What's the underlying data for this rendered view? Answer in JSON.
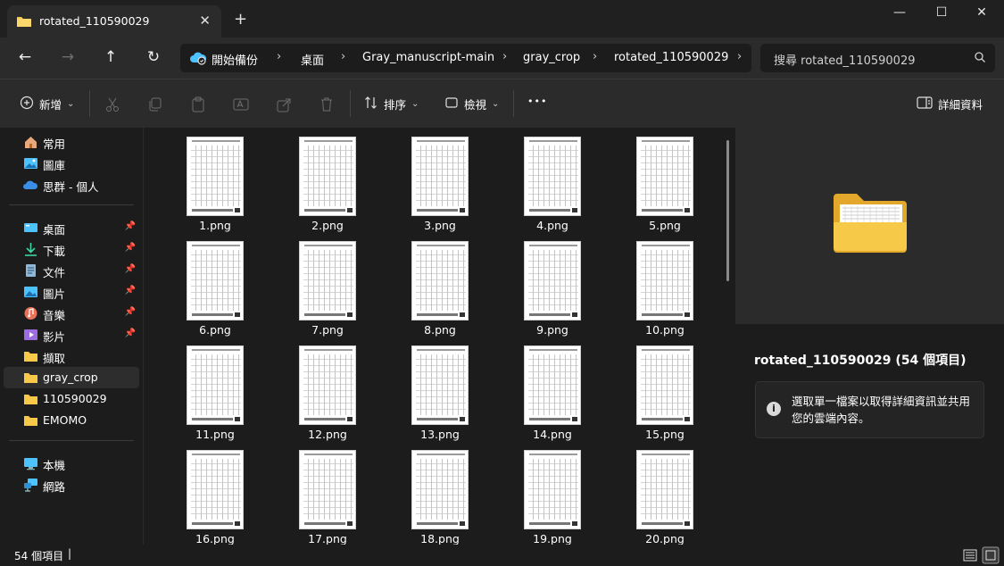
{
  "window": {
    "tab_title": "rotated_110590029",
    "tab_close": "✕",
    "new_tab": "+",
    "minimize": "—",
    "maximize": "☐",
    "close": "✕"
  },
  "nav": {
    "back": "←",
    "forward": "→",
    "up": "↑",
    "refresh": "↻",
    "breadcrumb": [
      {
        "label": "開始備份"
      },
      {
        "label": "桌面"
      },
      {
        "label": "Gray_manuscript-main"
      },
      {
        "label": "gray_crop"
      },
      {
        "label": "rotated_110590029"
      }
    ],
    "separator": "›",
    "search_placeholder": "搜尋 rotated_110590029"
  },
  "toolbar": {
    "new_label": "新增",
    "sort_label": "排序",
    "view_label": "檢視",
    "more": "•••",
    "details_label": "詳細資料",
    "dropdown": "⌄"
  },
  "sidebar": {
    "quick": [
      {
        "label": "常用",
        "icon": "home-icon"
      },
      {
        "label": "圖庫",
        "icon": "gallery-icon"
      },
      {
        "label": "思群 - 個人",
        "icon": "onedrive-cloud-icon"
      }
    ],
    "pinned": [
      {
        "label": "桌面",
        "icon": "desktop-icon",
        "pinned": true
      },
      {
        "label": "下載",
        "icon": "download-icon",
        "pinned": true
      },
      {
        "label": "文件",
        "icon": "documents-icon",
        "pinned": true
      },
      {
        "label": "圖片",
        "icon": "pictures-icon",
        "pinned": true
      },
      {
        "label": "音樂",
        "icon": "music-icon",
        "pinned": true
      },
      {
        "label": "影片",
        "icon": "videos-icon",
        "pinned": true
      },
      {
        "label": "擷取",
        "icon": "folder-icon",
        "pinned": false
      },
      {
        "label": "gray_crop",
        "icon": "folder-icon",
        "pinned": false,
        "selected": true
      },
      {
        "label": "110590029",
        "icon": "folder-icon",
        "pinned": false
      },
      {
        "label": "EMOMO",
        "icon": "folder-icon",
        "pinned": false
      }
    ],
    "pin_glyph": "📌",
    "devices": [
      {
        "label": "本機",
        "icon": "this-pc-icon"
      },
      {
        "label": "網路",
        "icon": "network-icon"
      }
    ]
  },
  "files": [
    {
      "name": "1.png"
    },
    {
      "name": "2.png"
    },
    {
      "name": "3.png"
    },
    {
      "name": "4.png"
    },
    {
      "name": "5.png"
    },
    {
      "name": "6.png"
    },
    {
      "name": "7.png"
    },
    {
      "name": "8.png"
    },
    {
      "name": "9.png"
    },
    {
      "name": "10.png"
    },
    {
      "name": "11.png"
    },
    {
      "name": "12.png"
    },
    {
      "name": "13.png"
    },
    {
      "name": "14.png"
    },
    {
      "name": "15.png"
    },
    {
      "name": "16.png"
    },
    {
      "name": "17.png"
    },
    {
      "name": "18.png"
    },
    {
      "name": "19.png"
    },
    {
      "name": "20.png"
    }
  ],
  "details": {
    "title": "rotated_110590029 (54 個項目)",
    "info_icon": "i",
    "info_text": "選取單一檔案以取得詳細資訊並共用您的雲端內容。"
  },
  "status": {
    "count": "54 個項目",
    "cursor": "|"
  },
  "colors": {
    "folder_yellow": "#f7c948",
    "accent_blue": "#4cc2ff",
    "background": "#1c1c1c",
    "panel": "#2b2b2b"
  }
}
